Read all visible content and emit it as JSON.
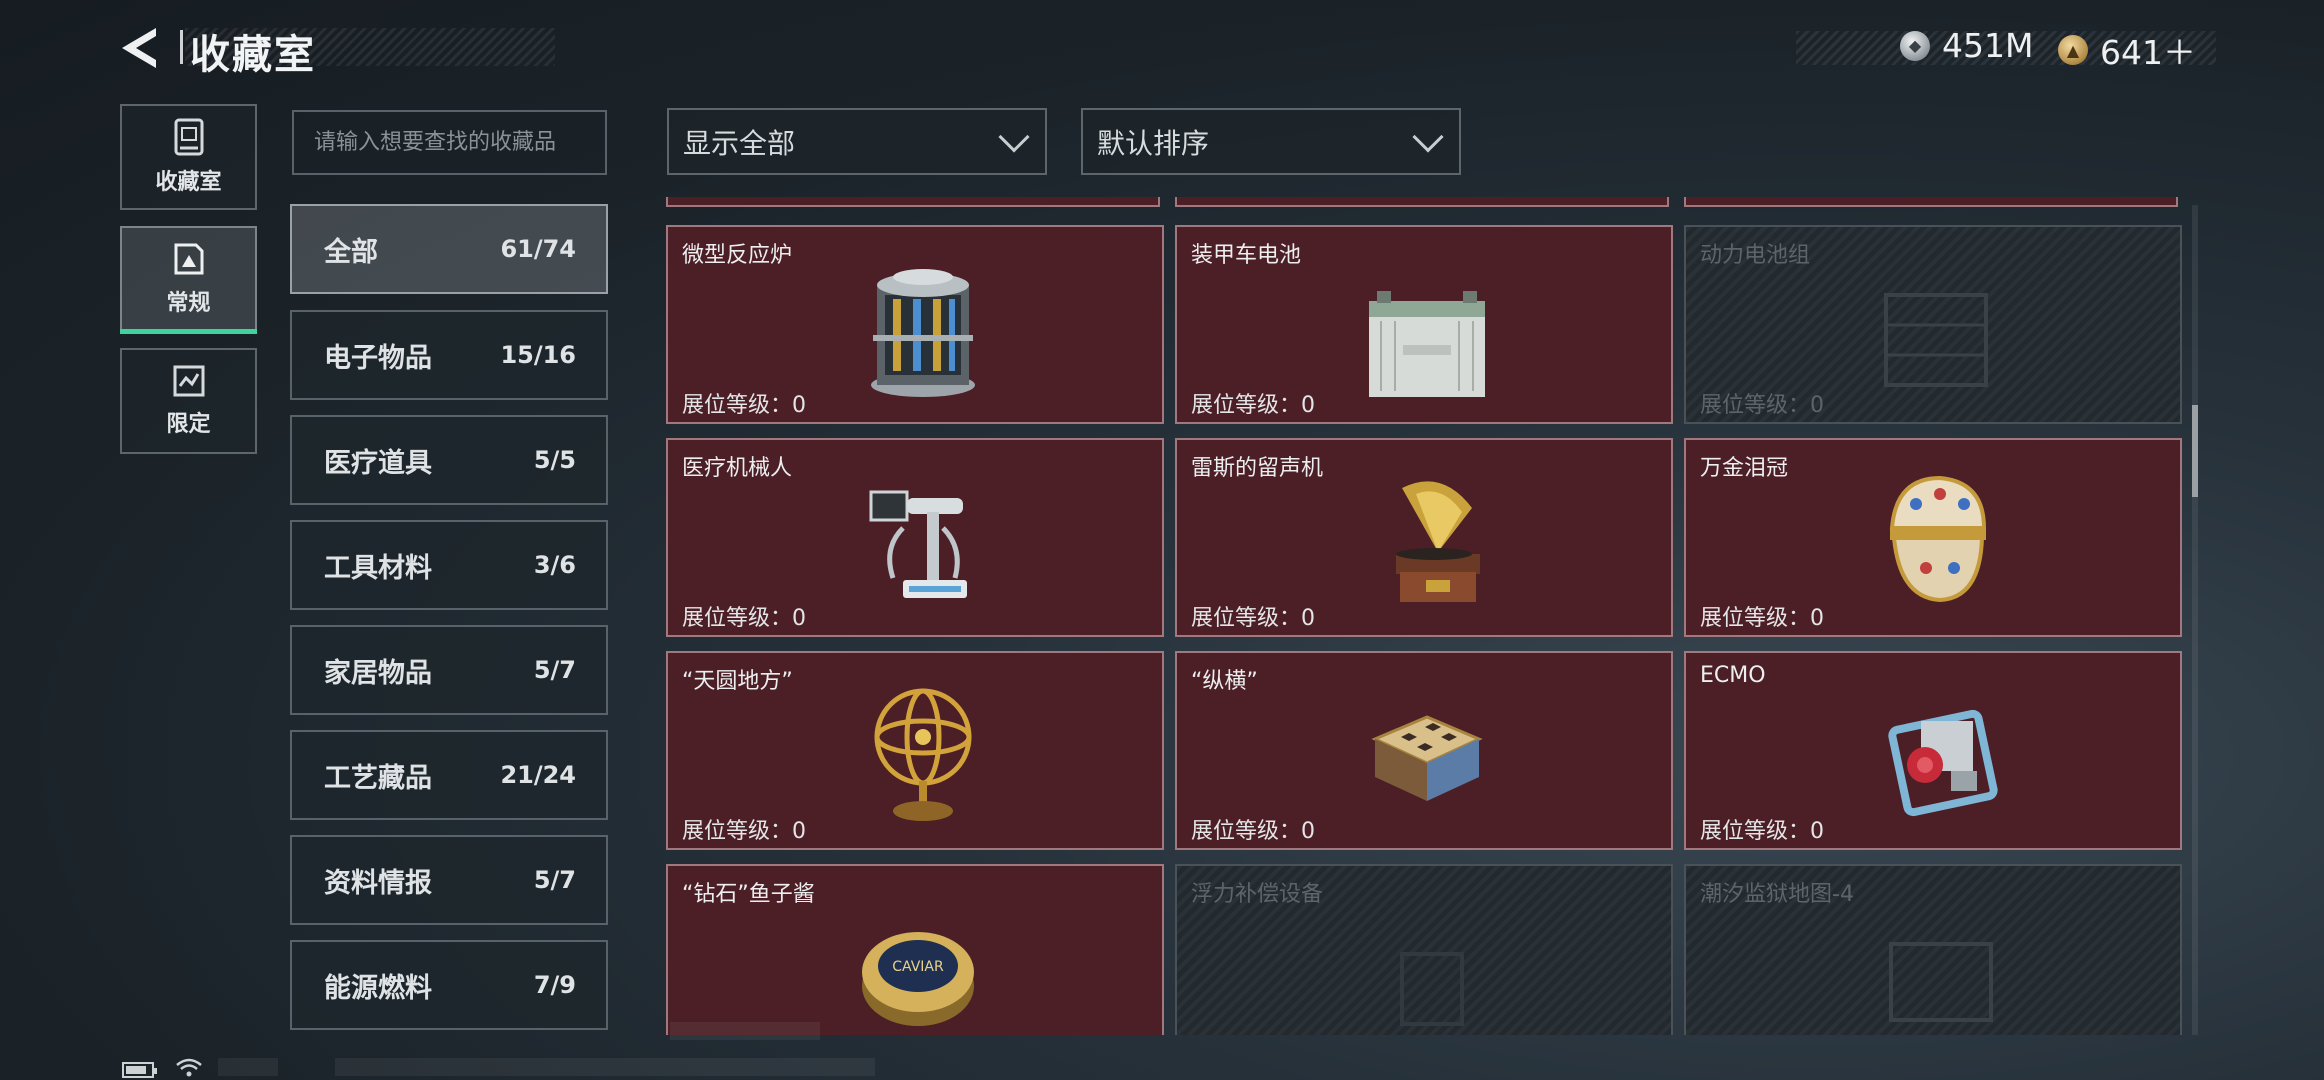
{
  "header": {
    "title": "收藏室",
    "currencies": [
      {
        "icon": "silver-coin-icon",
        "value": "451M"
      },
      {
        "icon": "gold-coin-icon",
        "value": "641＋"
      }
    ]
  },
  "nav_tabs": [
    {
      "label": "收藏室",
      "icon": "collection-room-icon",
      "active": false
    },
    {
      "label": "常规",
      "icon": "regular-icon",
      "active": true
    },
    {
      "label": "限定",
      "icon": "limited-icon",
      "active": false
    }
  ],
  "search": {
    "placeholder": "请输入想要查找的收藏品"
  },
  "filters": {
    "display": "显示全部",
    "sort": "默认排序"
  },
  "categories": [
    {
      "name": "全部",
      "count": "61/74",
      "active": true
    },
    {
      "name": "电子物品",
      "count": "15/16"
    },
    {
      "name": "医疗道具",
      "count": "5/5"
    },
    {
      "name": "工具材料",
      "count": "3/6"
    },
    {
      "name": "家居物品",
      "count": "5/7"
    },
    {
      "name": "工艺藏品",
      "count": "21/24"
    },
    {
      "name": "资料情报",
      "count": "5/7"
    },
    {
      "name": "能源燃料",
      "count": "7/9"
    }
  ],
  "items": [
    {
      "name": "微型反应炉",
      "level": "展位等级：0",
      "unlocked": true,
      "icon": "reactor-icon"
    },
    {
      "name": "装甲车电池",
      "level": "展位等级：0",
      "unlocked": true,
      "icon": "battery-box-icon"
    },
    {
      "name": "动力电池组",
      "level": "展位等级：0",
      "unlocked": false,
      "icon": "battery-pack-icon"
    },
    {
      "name": "医疗机械人",
      "level": "展位等级：0",
      "unlocked": true,
      "icon": "medical-robot-icon"
    },
    {
      "name": "雷斯的留声机",
      "level": "展位等级：0",
      "unlocked": true,
      "icon": "gramophone-icon"
    },
    {
      "name": "万金泪冠",
      "level": "展位等级：0",
      "unlocked": true,
      "icon": "jeweled-egg-icon"
    },
    {
      "name": "“天圆地方”",
      "level": "展位等级：0",
      "unlocked": true,
      "icon": "armillary-sphere-icon"
    },
    {
      "name": "“纵横”",
      "level": "展位等级：0",
      "unlocked": true,
      "icon": "chess-box-icon"
    },
    {
      "name": "ECMO",
      "level": "展位等级：0",
      "unlocked": true,
      "icon": "ecmo-machine-icon"
    },
    {
      "name": "“钻石”鱼子酱",
      "level": "",
      "unlocked": true,
      "icon": "caviar-tin-icon"
    },
    {
      "name": "浮力补偿设备",
      "level": "",
      "unlocked": false,
      "icon": "buoyancy-device-icon"
    },
    {
      "name": "潮汐监狱地图-4",
      "level": "",
      "unlocked": false,
      "icon": "map-icon"
    }
  ],
  "caviar_label": "CAVIAR",
  "colors": {
    "card_fill": "#4c1f27",
    "card_border": "#a0787e",
    "active_tab_accent": "#3fd49c",
    "locked_card": "#222a30"
  }
}
